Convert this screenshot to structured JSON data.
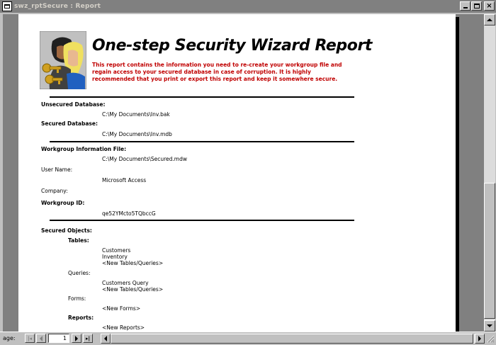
{
  "window": {
    "title": "swz_rptSecure : Report",
    "minimize_icon": "minimize-icon",
    "maximize_icon": "maximize-icon",
    "close_icon": "close-icon",
    "close_glyph": "×"
  },
  "report": {
    "title": "One-step Security Wizard Report",
    "intro": "This report contains the information you need to re-create your workgroup file and regain access to your secured database in case of corruption. It is highly recommended that you print or export this report and keep it somewhere secure.",
    "intro_color": "#c00000",
    "logo_icon": "security-keys-logo-icon",
    "unsecured_db": {
      "label": "Unsecured Database:",
      "value": "C:\\My Documents\\Inv.bak"
    },
    "secured_db": {
      "label": "Secured Database:",
      "value": "C:\\My Documents\\Inv.mdb"
    },
    "workgroup_file": {
      "label": "Workgroup Information File:",
      "value": "C:\\My Documents\\Secured.mdw"
    },
    "user_name": {
      "label": "User Name:",
      "value": "Microsoft Access"
    },
    "company": {
      "label": "Company:",
      "value": ""
    },
    "workgroup_id": {
      "label": "Workgroup ID:",
      "value": "qe52YMcto5TQbccG"
    },
    "secured_objects": {
      "label": "Secured Objects:",
      "tables": {
        "label": "Tables:",
        "items": [
          "Customers",
          "Inventory",
          "<New Tables/Queries>"
        ]
      },
      "queries": {
        "label": "Queries:",
        "items": [
          "Customers Query",
          "<New Tables/Queries>"
        ]
      },
      "forms": {
        "label": "Forms:",
        "items": [
          "<New Forms>"
        ]
      },
      "reports": {
        "label": "Reports:",
        "items": [
          "<New Reports>"
        ]
      }
    }
  },
  "statusbar": {
    "page_label": "age:",
    "page_value": "1",
    "first_icon": "first-record-icon",
    "prev_icon": "previous-record-icon",
    "next_icon": "next-record-icon",
    "last_icon": "last-record-icon"
  }
}
